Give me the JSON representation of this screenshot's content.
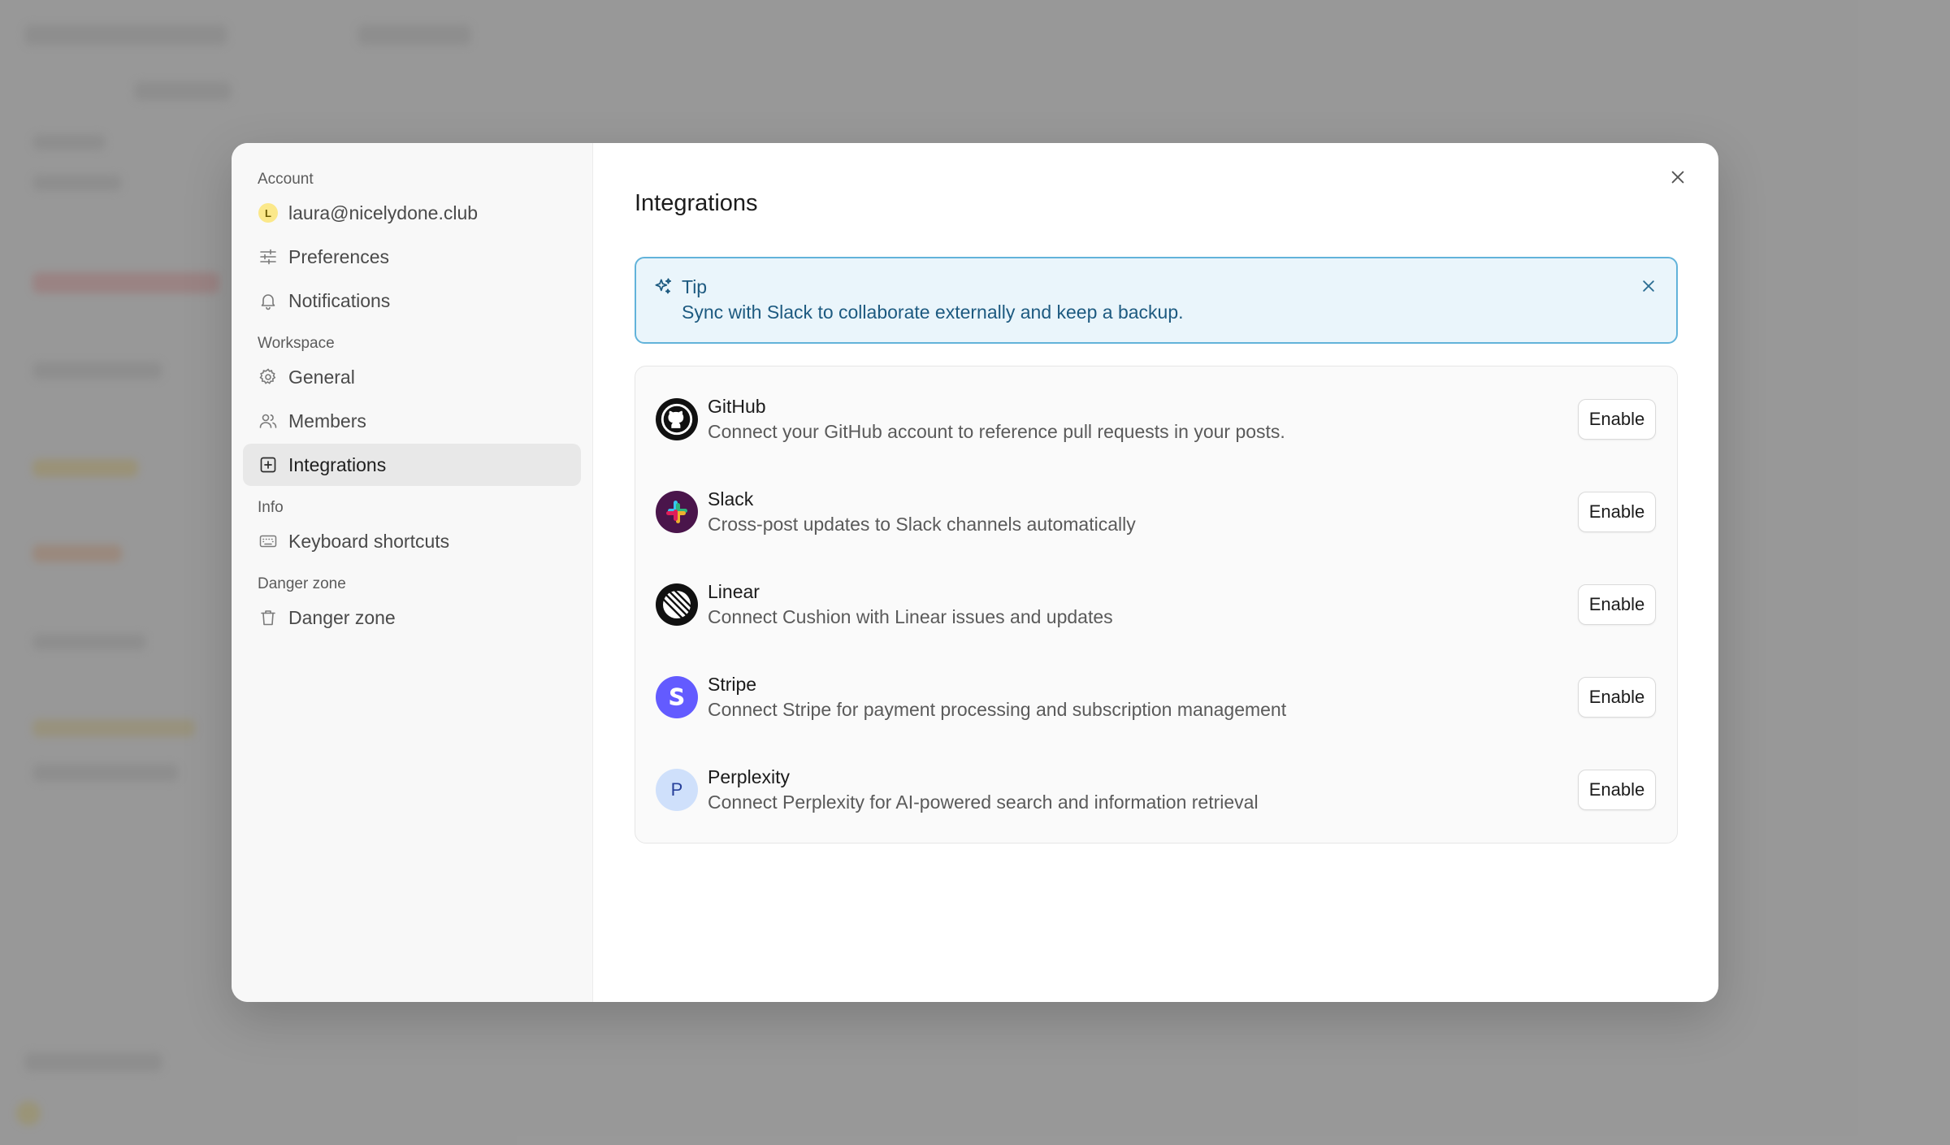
{
  "sidebar": {
    "sections": {
      "account": "Account",
      "workspace": "Workspace",
      "info": "Info",
      "danger": "Danger zone"
    },
    "items": [
      {
        "label": "laura@nicelydone.club",
        "icon": "avatar-L"
      },
      {
        "label": "Preferences",
        "icon": "sliders-icon"
      },
      {
        "label": "Notifications",
        "icon": "bell-icon"
      },
      {
        "label": "General",
        "icon": "gear-icon"
      },
      {
        "label": "Members",
        "icon": "users-icon"
      },
      {
        "label": "Integrations",
        "icon": "plus-square-icon",
        "active": true
      },
      {
        "label": "Keyboard shortcuts",
        "icon": "keyboard-icon"
      },
      {
        "label": "Danger zone",
        "icon": "trash-icon"
      }
    ],
    "avatar_letter": "L"
  },
  "main": {
    "title": "Integrations",
    "tip": {
      "title": "Tip",
      "text": "Sync with Slack to collaborate externally and keep a backup."
    },
    "integrations": [
      {
        "name": "GitHub",
        "description": "Connect your GitHub account to reference pull requests in your posts.",
        "button": "Enable"
      },
      {
        "name": "Slack",
        "description": "Cross-post updates to Slack channels automatically",
        "button": "Enable"
      },
      {
        "name": "Linear",
        "description": "Connect Cushion with Linear issues and updates",
        "button": "Enable"
      },
      {
        "name": "Stripe",
        "description": "Connect Stripe for payment processing and subscription management",
        "button": "Enable"
      },
      {
        "name": "Perplexity",
        "description": "Connect Perplexity for AI-powered search and information retrieval",
        "button": "Enable",
        "logo_letter": "P"
      }
    ]
  },
  "colors": {
    "tip_border": "#62b3da",
    "tip_bg": "#eaf5fb",
    "tip_text": "#1d5a80",
    "active_nav_bg": "#e8e8e8",
    "stripe": "#635bff",
    "perplexity_bg": "#cfe0fb"
  }
}
